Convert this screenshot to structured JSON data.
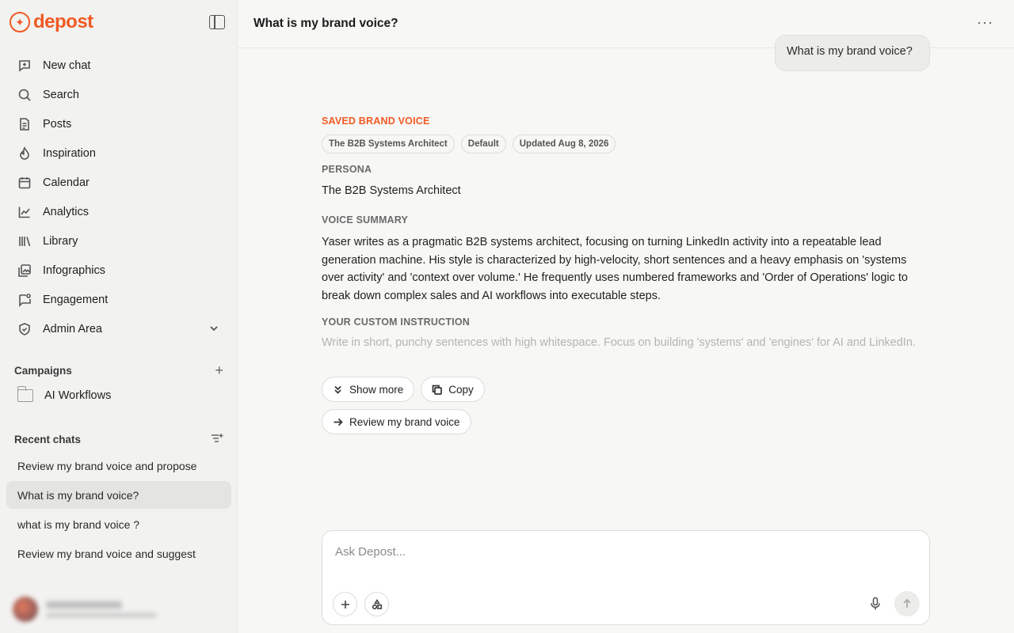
{
  "brand": {
    "name": "depost",
    "color": "#f05a24"
  },
  "sidebar": {
    "nav": [
      {
        "label": "New chat",
        "icon": "new-chat-icon"
      },
      {
        "label": "Search",
        "icon": "search-icon"
      },
      {
        "label": "Posts",
        "icon": "document-icon"
      },
      {
        "label": "Inspiration",
        "icon": "flame-icon"
      },
      {
        "label": "Calendar",
        "icon": "calendar-icon"
      },
      {
        "label": "Analytics",
        "icon": "line-chart-icon"
      },
      {
        "label": "Library",
        "icon": "library-icon"
      },
      {
        "label": "Infographics",
        "icon": "image-gallery-icon"
      },
      {
        "label": "Engagement",
        "icon": "message-flag-icon"
      },
      {
        "label": "Admin Area",
        "icon": "shield-icon"
      }
    ],
    "campaigns_title": "Campaigns",
    "campaigns": [
      {
        "label": "AI Workflows"
      }
    ],
    "recent_title": "Recent chats",
    "recent_chats": [
      {
        "label": "Review my brand voice and propose"
      },
      {
        "label": "What is my brand voice?",
        "active": true
      },
      {
        "label": "what is my brand voice ?"
      },
      {
        "label": "Review my brand voice and suggest"
      }
    ]
  },
  "header": {
    "title": "What is my brand voice?",
    "more": "···"
  },
  "conversation": {
    "user_message": "What is my brand voice?",
    "answer": {
      "eyebrow": "SAVED BRAND VOICE",
      "chips": [
        "The B2B Systems Architect",
        "Default",
        "Updated Aug 8, 2026"
      ],
      "persona_label": "PERSONA",
      "persona": "The B2B Systems Architect",
      "summary_label": "VOICE SUMMARY",
      "summary": "Yaser writes as a pragmatic B2B systems architect, focusing on turning LinkedIn activity into a repeatable lead generation machine. His style is characterized by high-velocity, short sentences and a heavy emphasis on 'systems over activity' and 'context over volume.' He frequently uses numbered frameworks and 'Order of Operations' logic to break down complex sales and AI workflows into executable steps.",
      "custom_label": "YOUR CUSTOM INSTRUCTION",
      "custom": "Write in short, punchy sentences with high whitespace. Focus on building 'systems' and 'engines' for AI and LinkedIn."
    },
    "actions": {
      "show_more": "Show more",
      "copy": "Copy",
      "review": "Review my brand voice"
    }
  },
  "composer": {
    "placeholder": "Ask Depost..."
  }
}
